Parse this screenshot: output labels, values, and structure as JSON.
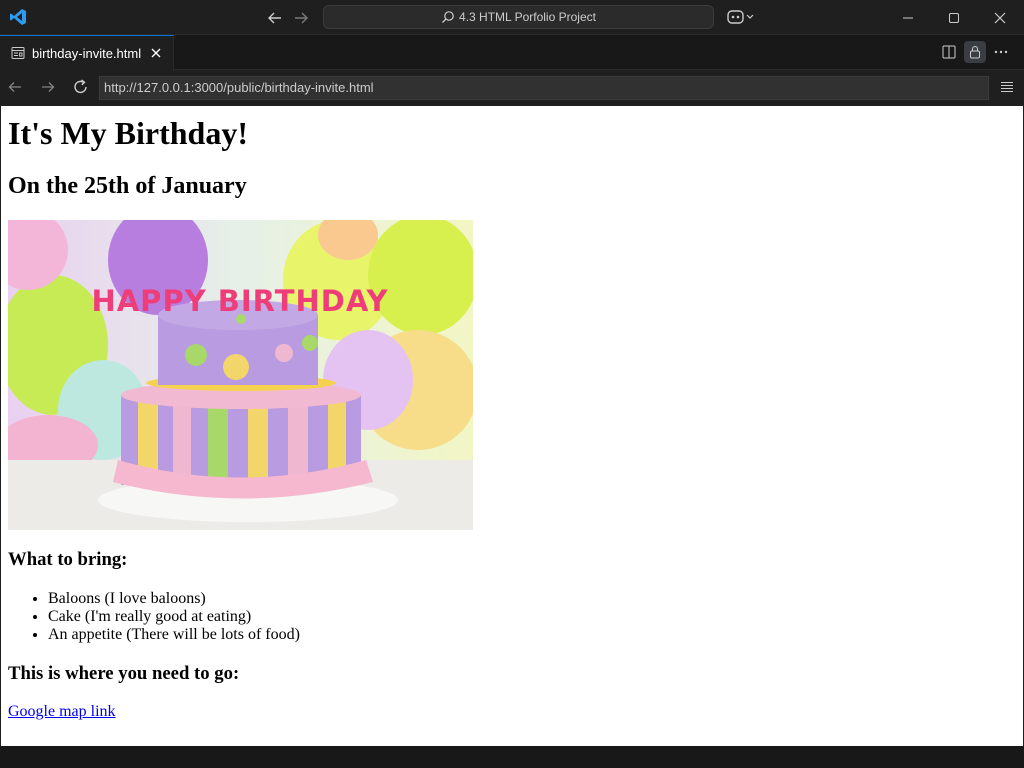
{
  "titlebar": {
    "command_center": "4.3 HTML Porfolio Project"
  },
  "tab": {
    "label": "birthday-invite.html"
  },
  "browser": {
    "url": "http://127.0.0.1:3000/public/birthday-invite.html"
  },
  "page": {
    "heading": "It's My Birthday!",
    "subheading": "On the 25th of January",
    "image_text": "HAPPY BIRTHDAY",
    "bring_heading": "What to bring:",
    "bring_items": [
      "Baloons (I love baloons)",
      "Cake (I'm really good at eating)",
      "An appetite (There will be lots of food)"
    ],
    "go_heading": "This is where you need to go:",
    "map_link": "Google map link"
  },
  "colors": {
    "accent": "#0078d4",
    "link": "#0000ee",
    "chrome": "#1f1f1f"
  }
}
